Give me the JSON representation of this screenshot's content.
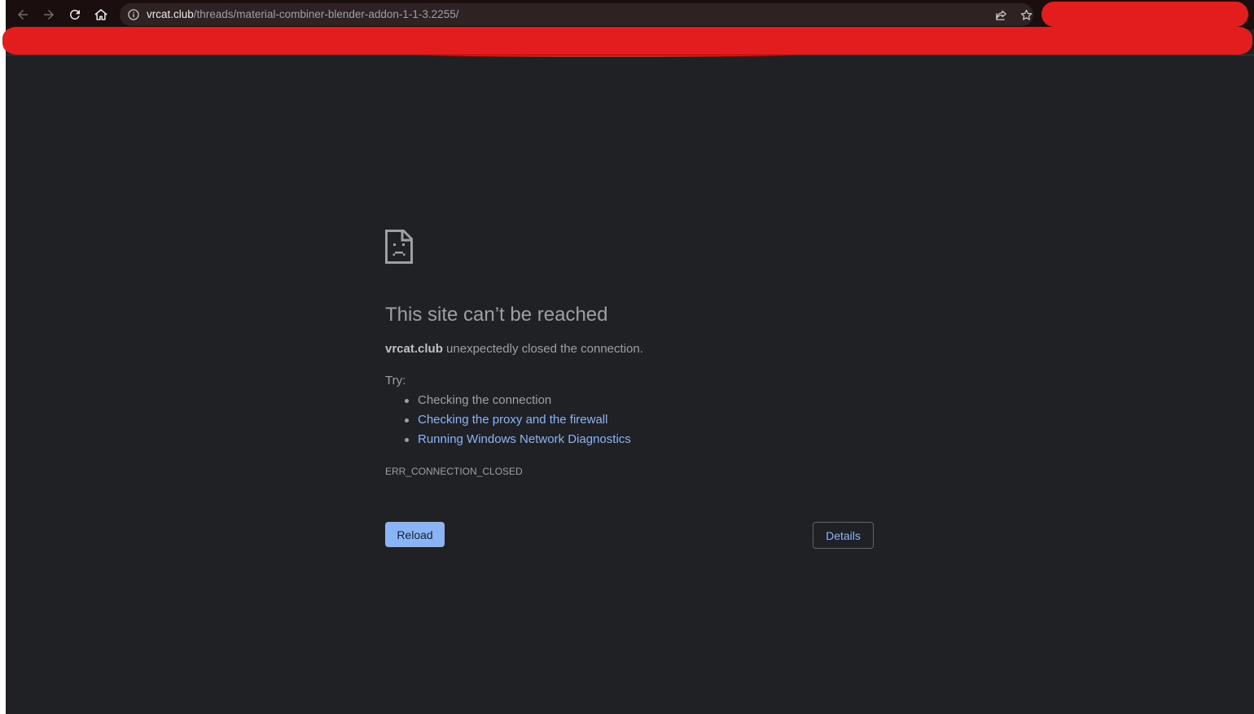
{
  "browser": {
    "url_host": "vrcat.club",
    "url_path": "/threads/material-combiner-blender-addon-1-1-3.2255/",
    "icons": [
      "back-arrow-icon",
      "forward-arrow-icon",
      "reload-icon",
      "home-icon",
      "info-icon",
      "share-icon",
      "star-icon"
    ]
  },
  "error_page": {
    "icon": "sad-file-icon",
    "title": "This site can’t be reached",
    "host": "vrcat.club",
    "summary_rest": " unexpectedly closed the connection.",
    "try_label": "Try:",
    "suggestions": [
      {
        "text": "Checking the connection",
        "is_link": false
      },
      {
        "text": "Checking the proxy and the firewall",
        "is_link": true
      },
      {
        "text": "Running Windows Network Diagnostics",
        "is_link": true
      }
    ],
    "error_code": "ERR_CONNECTION_CLOSED",
    "reload_label": "Reload",
    "details_label": "Details"
  },
  "colors": {
    "page_background": "#202124",
    "link": "#8ab4f8",
    "primary_button": "#8ab4f8",
    "redaction": "#e31d1d"
  }
}
